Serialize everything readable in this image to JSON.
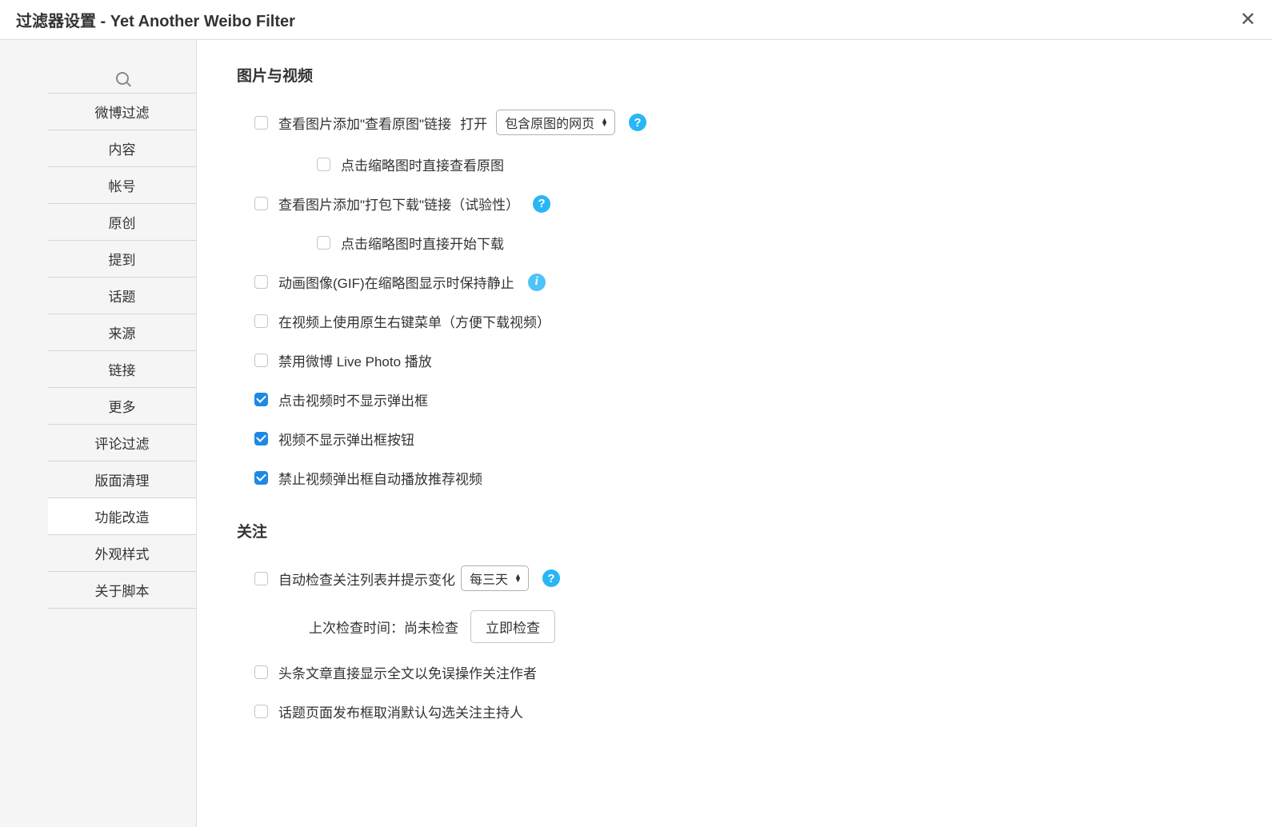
{
  "header": {
    "title": "过滤器设置 - Yet Another Weibo Filter"
  },
  "sidebar": {
    "items": [
      {
        "label": "微博过滤"
      },
      {
        "label": "内容"
      },
      {
        "label": "帐号"
      },
      {
        "label": "原创"
      },
      {
        "label": "提到"
      },
      {
        "label": "话题"
      },
      {
        "label": "来源"
      },
      {
        "label": "链接"
      },
      {
        "label": "更多"
      },
      {
        "label": "评论过滤"
      },
      {
        "label": "版面清理"
      },
      {
        "label": "功能改造"
      },
      {
        "label": "外观样式"
      },
      {
        "label": "关于脚本"
      }
    ]
  },
  "sections": {
    "media": {
      "title": "图片与视频",
      "view_original_link": "查看图片添加\"查看原图\"链接",
      "open_label": "打开",
      "open_select": "包含原图的网页",
      "click_thumbnail_view": "点击缩略图时直接查看原图",
      "download_link": "查看图片添加\"打包下载\"链接（试验性）",
      "click_thumbnail_download": "点击缩略图时直接开始下载",
      "gif_still": "动画图像(GIF)在缩略图显示时保持静止",
      "native_context": "在视频上使用原生右键菜单（方便下载视频）",
      "disable_livephoto": "禁用微博 Live Photo 播放",
      "video_no_popup": "点击视频时不显示弹出框",
      "video_no_popup_btn": "视频不显示弹出框按钮",
      "no_autoplay_recommend": "禁止视频弹出框自动播放推荐视频"
    },
    "follow": {
      "title": "关注",
      "auto_check": "自动检查关注列表并提示变化",
      "interval_select": "每三天",
      "last_check_label": "上次检查时间：",
      "last_check_value": "尚未检查",
      "check_now_btn": "立即检查",
      "headline_fulltext": "头条文章直接显示全文以免误操作关注作者",
      "topic_uncheck": "话题页面发布框取消默认勾选关注主持人"
    }
  }
}
